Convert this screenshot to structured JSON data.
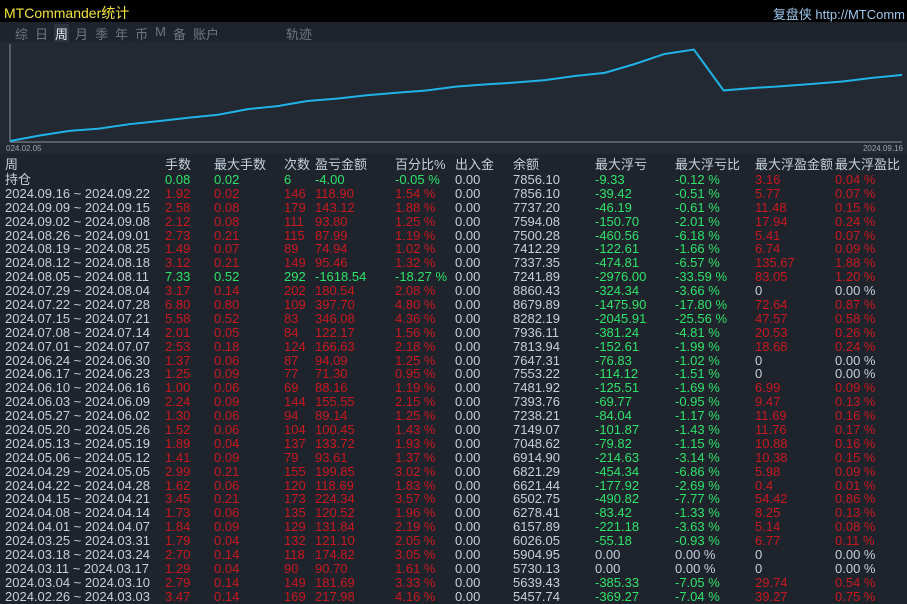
{
  "app": {
    "title": "MTCommander统计",
    "brand": "复盘侠 http://MTComm"
  },
  "tabs": [
    {
      "label": "综"
    },
    {
      "label": "日"
    },
    {
      "label": "周",
      "active": true
    },
    {
      "label": "月"
    },
    {
      "label": "季"
    },
    {
      "label": "年"
    },
    {
      "label": "币"
    },
    {
      "label": "M"
    },
    {
      "label": "备"
    },
    {
      "label": "账户"
    },
    {
      "label": "轨迹"
    }
  ],
  "colors": {
    "line": "#1fb3e8",
    "red": "#c8181f",
    "green": "#2ee26a",
    "title": "#f2e23a"
  },
  "chart_data": {
    "type": "line",
    "x_start_label": "024.02.05",
    "x_end_label": "2024.09.16",
    "x": [
      "2024.02.26",
      "2024.03.04",
      "2024.03.11",
      "2024.03.18",
      "2024.03.25",
      "2024.04.01",
      "2024.04.08",
      "2024.04.15",
      "2024.04.22",
      "2024.04.29",
      "2024.05.06",
      "2024.05.13",
      "2024.05.20",
      "2024.05.27",
      "2024.06.03",
      "2024.06.10",
      "2024.06.17",
      "2024.06.24",
      "2024.07.01",
      "2024.07.08",
      "2024.07.15",
      "2024.07.22",
      "2024.07.29",
      "2024.08.05",
      "2024.08.12",
      "2024.08.19",
      "2024.08.26",
      "2024.09.02",
      "2024.09.09",
      "2024.09.16"
    ],
    "y": [
      5457.74,
      5639.43,
      5730.13,
      5904.95,
      6026.05,
      6157.89,
      6278.41,
      6502.75,
      6621.44,
      6821.29,
      6914.9,
      7048.62,
      7149.07,
      7238.21,
      7393.76,
      7481.92,
      7553.22,
      7647.31,
      7813.94,
      7936.11,
      8282.19,
      8679.89,
      8860.43,
      7241.89,
      7337.35,
      7412.29,
      7500.28,
      7594.08,
      7737.2,
      7856.1
    ],
    "ylim": [
      5200,
      9000
    ]
  },
  "table": {
    "headers": [
      "周",
      "手数",
      "最大手数",
      "次数",
      "盈亏金额",
      "百分比%",
      "出入金",
      "余额",
      "最大浮亏",
      "最大浮亏比",
      "最大浮盈金额",
      "最大浮盈比"
    ],
    "rows": [
      [
        "持仓",
        "0.08",
        "0.02",
        "6",
        "-4.00",
        "-0.05 %",
        "0.00",
        "7856.10",
        "-9.33",
        "-0.12 %",
        "3.16",
        "0.04 %"
      ],
      [
        "2024.09.16 ~ 2024.09.22",
        "1.92",
        "0.02",
        "146",
        "118.90",
        "1.54 %",
        "0.00",
        "7856.10",
        "-39.42",
        "-0.51 %",
        "5.77",
        "0.07 %"
      ],
      [
        "2024.09.09 ~ 2024.09.15",
        "2.58",
        "0.08",
        "179",
        "143.12",
        "1.88 %",
        "0.00",
        "7737.20",
        "-46.19",
        "-0.61 %",
        "11.48",
        "0.15 %"
      ],
      [
        "2024.09.02 ~ 2024.09.08",
        "2.12",
        "0.08",
        "111",
        "93.80",
        "1.25 %",
        "0.00",
        "7594.08",
        "-150.70",
        "-2.01 %",
        "17.94",
        "0.24 %"
      ],
      [
        "2024.08.26 ~ 2024.09.01",
        "2.73",
        "0.21",
        "115",
        "87.99",
        "1.19 %",
        "0.00",
        "7500.28",
        "-460.56",
        "-6.18 %",
        "5.41",
        "0.07 %"
      ],
      [
        "2024.08.19 ~ 2024.08.25",
        "1.49",
        "0.07",
        "89",
        "74.94",
        "1.02 %",
        "0.00",
        "7412.29",
        "-122.61",
        "-1.66 %",
        "6.74",
        "0.09 %"
      ],
      [
        "2024.08.12 ~ 2024.08.18",
        "3.12",
        "0.21",
        "149",
        "95.46",
        "1.32 %",
        "0.00",
        "7337.35",
        "-474.81",
        "-6.57 %",
        "135.67",
        "1.88 %"
      ],
      [
        "2024.08.05 ~ 2024.08.11",
        "7.33",
        "0.52",
        "292",
        "-1618.54",
        "-18.27 %",
        "0.00",
        "7241.89",
        "-2976.00",
        "-33.59 %",
        "83.05",
        "1.20 %"
      ],
      [
        "2024.07.29 ~ 2024.08.04",
        "3.17",
        "0.14",
        "202",
        "180.54",
        "2.08 %",
        "0.00",
        "8860.43",
        "-324.34",
        "-3.66 %",
        "0",
        "0.00 %"
      ],
      [
        "2024.07.22 ~ 2024.07.28",
        "6.80",
        "0.80",
        "109",
        "397.70",
        "4.80 %",
        "0.00",
        "8679.89",
        "-1475.90",
        "-17.80 %",
        "72.64",
        "0.87 %"
      ],
      [
        "2024.07.15 ~ 2024.07.21",
        "5.58",
        "0.52",
        "83",
        "346.08",
        "4.36 %",
        "0.00",
        "8282.19",
        "-2045.91",
        "-25.56 %",
        "47.57",
        "0.58 %"
      ],
      [
        "2024.07.08 ~ 2024.07.14",
        "2.01",
        "0.05",
        "84",
        "122.17",
        "1.56 %",
        "0.00",
        "7936.11",
        "-381.24",
        "-4.81 %",
        "20.53",
        "0.26 %"
      ],
      [
        "2024.07.01 ~ 2024.07.07",
        "2.53",
        "0.18",
        "124",
        "166.63",
        "2.18 %",
        "0.00",
        "7813.94",
        "-152.61",
        "-1.99 %",
        "18.68",
        "0.24 %"
      ],
      [
        "2024.06.24 ~ 2024.06.30",
        "1.37",
        "0.06",
        "87",
        "94.09",
        "1.25 %",
        "0.00",
        "7647.31",
        "-76.83",
        "-1.02 %",
        "0",
        "0.00 %"
      ],
      [
        "2024.06.17 ~ 2024.06.23",
        "1.25",
        "0.09",
        "77",
        "71.30",
        "0.95 %",
        "0.00",
        "7553.22",
        "-114.12",
        "-1.51 %",
        "0",
        "0.00 %"
      ],
      [
        "2024.06.10 ~ 2024.06.16",
        "1.00",
        "0.06",
        "69",
        "88.16",
        "1.19 %",
        "0.00",
        "7481.92",
        "-125.51",
        "-1.69 %",
        "6.99",
        "0.09 %"
      ],
      [
        "2024.06.03 ~ 2024.06.09",
        "2.24",
        "0.09",
        "144",
        "155.55",
        "2.15 %",
        "0.00",
        "7393.76",
        "-69.77",
        "-0.95 %",
        "9.47",
        "0.13 %"
      ],
      [
        "2024.05.27 ~ 2024.06.02",
        "1.30",
        "0.06",
        "94",
        "89.14",
        "1.25 %",
        "0.00",
        "7238.21",
        "-84.04",
        "-1.17 %",
        "11.69",
        "0.16 %"
      ],
      [
        "2024.05.20 ~ 2024.05.26",
        "1.52",
        "0.06",
        "104",
        "100.45",
        "1.43 %",
        "0.00",
        "7149.07",
        "-101.87",
        "-1.43 %",
        "11.76",
        "0.17 %"
      ],
      [
        "2024.05.13 ~ 2024.05.19",
        "1.89",
        "0.04",
        "137",
        "133.72",
        "1.93 %",
        "0.00",
        "7048.62",
        "-79.82",
        "-1.15 %",
        "10.88",
        "0.16 %"
      ],
      [
        "2024.05.06 ~ 2024.05.12",
        "1.41",
        "0.09",
        "79",
        "93.61",
        "1.37 %",
        "0.00",
        "6914.90",
        "-214.63",
        "-3.14 %",
        "10.38",
        "0.15 %"
      ],
      [
        "2024.04.29 ~ 2024.05.05",
        "2.99",
        "0.21",
        "155",
        "199.85",
        "3.02 %",
        "0.00",
        "6821.29",
        "-454.34",
        "-6.86 %",
        "5.98",
        "0.09 %"
      ],
      [
        "2024.04.22 ~ 2024.04.28",
        "1.62",
        "0.06",
        "120",
        "118.69",
        "1.83 %",
        "0.00",
        "6621.44",
        "-177.92",
        "-2.69 %",
        "0.4",
        "0.01 %"
      ],
      [
        "2024.04.15 ~ 2024.04.21",
        "3.45",
        "0.21",
        "173",
        "224.34",
        "3.57 %",
        "0.00",
        "6502.75",
        "-490.82",
        "-7.77 %",
        "54.42",
        "0.86 %"
      ],
      [
        "2024.04.08 ~ 2024.04.14",
        "1.73",
        "0.06",
        "135",
        "120.52",
        "1.96 %",
        "0.00",
        "6278.41",
        "-83.42",
        "-1.33 %",
        "8.25",
        "0.13 %"
      ],
      [
        "2024.04.01 ~ 2024.04.07",
        "1.84",
        "0.09",
        "129",
        "131.84",
        "2.19 %",
        "0.00",
        "6157.89",
        "-221.18",
        "-3.63 %",
        "5.14",
        "0.08 %"
      ],
      [
        "2024.03.25 ~ 2024.03.31",
        "1.79",
        "0.04",
        "132",
        "121.10",
        "2.05 %",
        "0.00",
        "6026.05",
        "-55.18",
        "-0.93 %",
        "6.77",
        "0.11 %"
      ],
      [
        "2024.03.18 ~ 2024.03.24",
        "2.70",
        "0.14",
        "118",
        "174.82",
        "3.05 %",
        "0.00",
        "5904.95",
        "0.00",
        "0.00 %",
        "0",
        "0.00 %"
      ],
      [
        "2024.03.11 ~ 2024.03.17",
        "1.29",
        "0.04",
        "90",
        "90.70",
        "1.61 %",
        "0.00",
        "5730.13",
        "0.00",
        "0.00 %",
        "0",
        "0.00 %"
      ],
      [
        "2024.03.04 ~ 2024.03.10",
        "2.79",
        "0.14",
        "149",
        "181.69",
        "3.33 %",
        "0.00",
        "5639.43",
        "-385.33",
        "-7.05 %",
        "29.74",
        "0.54 %"
      ],
      [
        "2024.02.26 ~ 2024.03.03",
        "3.47",
        "0.14",
        "169",
        "217.98",
        "4.16 %",
        "0.00",
        "5457.74",
        "-369.27",
        "-7.04 %",
        "39.27",
        "0.75 %"
      ]
    ]
  }
}
